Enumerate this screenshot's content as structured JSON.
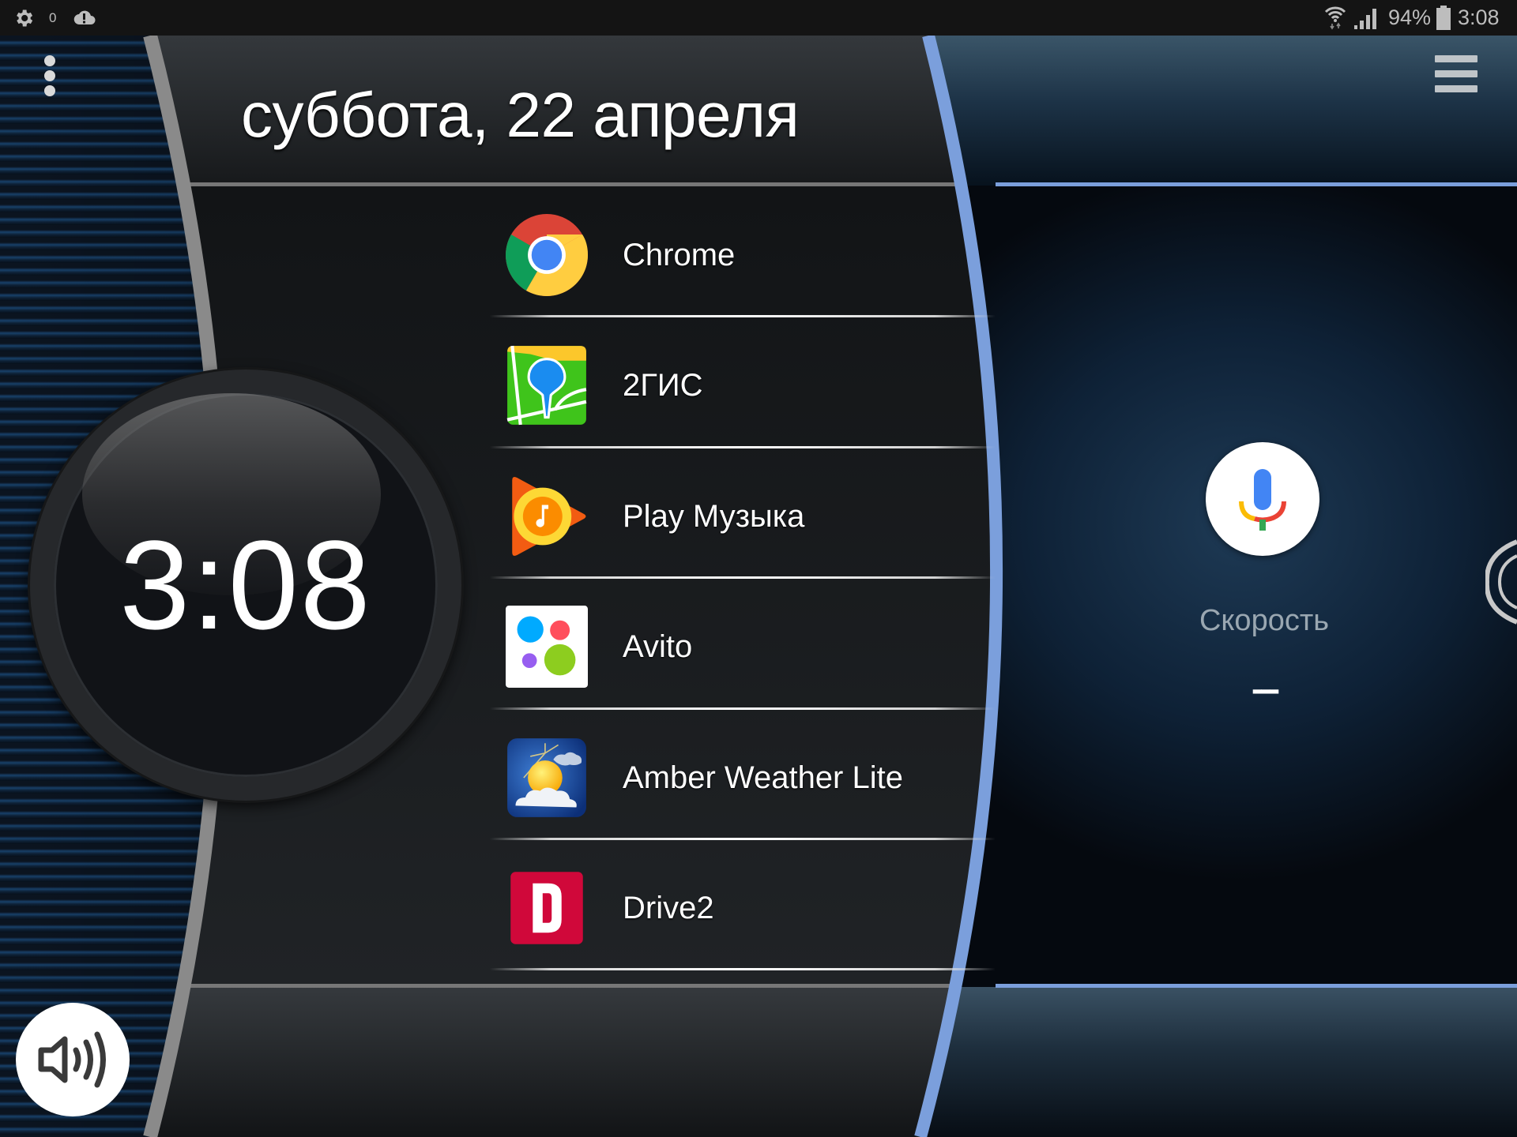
{
  "status_bar": {
    "left_icons": [
      "settings-gear-icon",
      "notification-count",
      "cloud-alert-icon"
    ],
    "notification_count": "0",
    "wifi": "wifi-icon",
    "signal": "cellular-signal-icon",
    "battery_percent": "94%",
    "battery_icon": "battery-icon",
    "time": "3:08"
  },
  "header": {
    "date": "суббота, 22 апреля"
  },
  "clock_widget": {
    "time": "3:08"
  },
  "apps": [
    {
      "label": "Chrome",
      "icon": "chrome-icon"
    },
    {
      "label": "2ГИС",
      "icon": "2gis-icon"
    },
    {
      "label": "Play Музыка",
      "icon": "play-music-icon"
    },
    {
      "label": "Avito",
      "icon": "avito-icon"
    },
    {
      "label": "Amber Weather Lite",
      "icon": "amber-weather-icon"
    },
    {
      "label": "Drive2",
      "icon": "drive2-icon"
    }
  ],
  "right_panel": {
    "voice_button": "google-mic-icon",
    "speed_label": "Скорость",
    "speed_value": "---"
  },
  "controls": {
    "menu": "hamburger-menu-icon",
    "overflow": "kebab-menu-icon",
    "volume": "volume-icon"
  },
  "colors": {
    "accent_blue": "#7b9fdc",
    "arc_grey": "#8a8a8a",
    "panel_dark": "#1c1f22",
    "speed_label": "#9aa7b1"
  }
}
